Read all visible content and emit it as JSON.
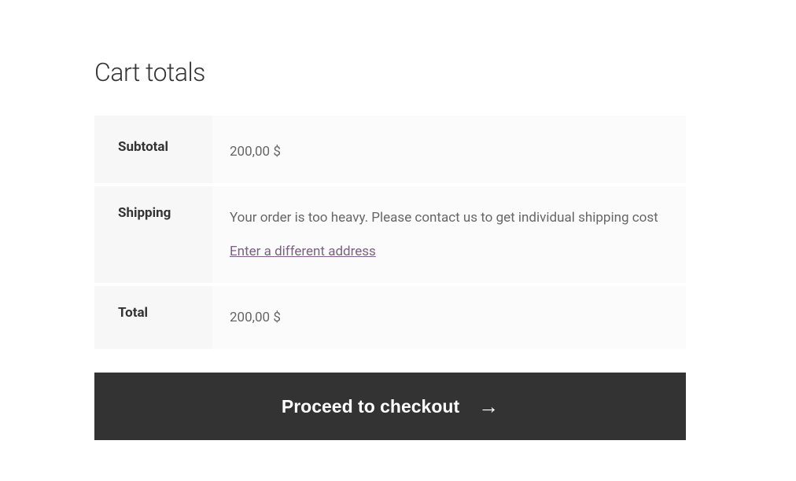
{
  "heading": "Cart totals",
  "rows": {
    "subtotal": {
      "label": "Subtotal",
      "value": "200,00 $"
    },
    "shipping": {
      "label": "Shipping",
      "message": "Your order is too heavy. Please contact us to get individual shipping cost",
      "link_text": "Enter a different address"
    },
    "total": {
      "label": "Total",
      "value": "200,00 $"
    }
  },
  "checkout_button": "Proceed to checkout"
}
